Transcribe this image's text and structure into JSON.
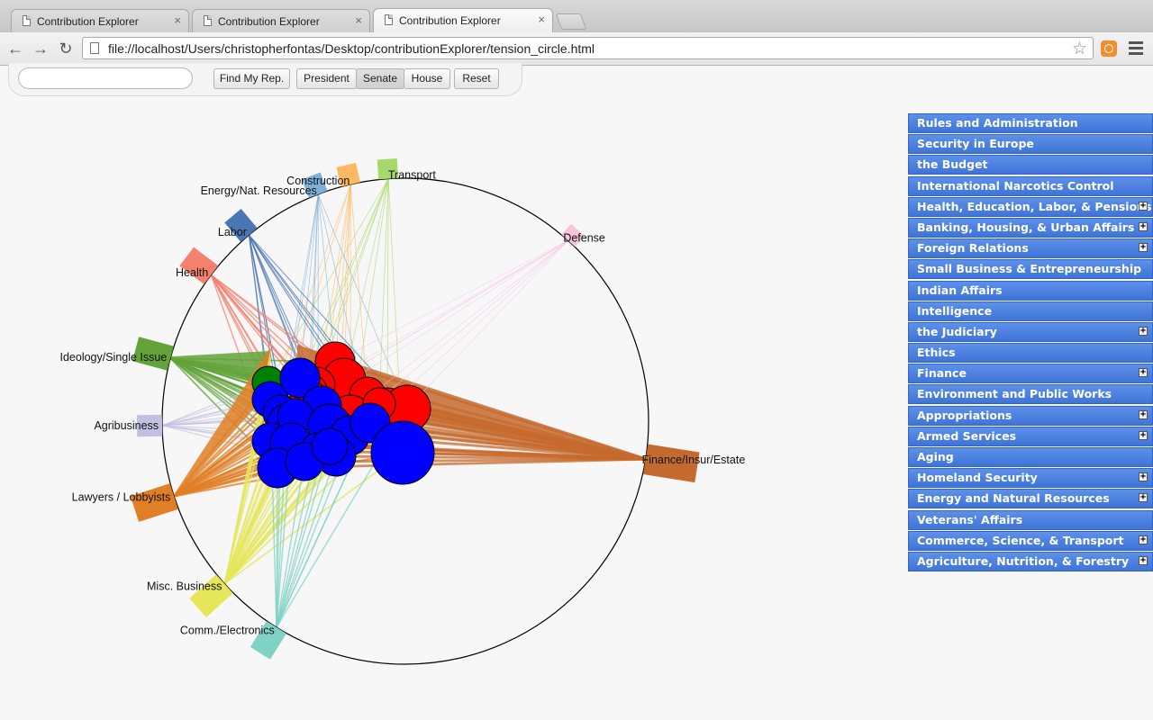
{
  "browser": {
    "tabs": [
      {
        "title": "Contribution Explorer",
        "active": false
      },
      {
        "title": "Contribution Explorer",
        "active": false
      },
      {
        "title": "Contribution Explorer",
        "active": true
      }
    ],
    "url": "file://localhost/Users/christopherfontas/Desktop/contributionExplorer/tension_circle.html",
    "close_glyph": "×"
  },
  "controls": {
    "search": {
      "value": "",
      "placeholder": ""
    },
    "find_label": "Find My Rep.",
    "chambers": [
      {
        "label": "President",
        "selected": false
      },
      {
        "label": "Senate",
        "selected": true
      },
      {
        "label": "House",
        "selected": false
      }
    ],
    "reset_label": "Reset"
  },
  "viz": {
    "ring": {
      "color": "#000000"
    },
    "party_colors": {
      "D": "#0000ff",
      "R": "#ff0000",
      "I": "#008000"
    },
    "sectors": [
      {
        "label": "Transport",
        "color": "#a6d96a",
        "weight": 2,
        "angle": 94
      },
      {
        "label": "Construction",
        "color": "#fdb863",
        "weight": 2,
        "angle": 103
      },
      {
        "label": "Energy/Nat. Resources",
        "color": "#7fb1d8",
        "weight": 2,
        "angle": 111
      },
      {
        "label": "Labor",
        "color": "#4a76b5",
        "weight": 3,
        "angle": 130
      },
      {
        "label": "Health",
        "color": "#f4806e",
        "weight": 4,
        "angle": 143
      },
      {
        "label": "Ideology/Single Issue",
        "color": "#63a33a",
        "weight": 5,
        "angle": 165
      },
      {
        "label": "Agribusiness",
        "color": "#c3bfe0",
        "weight": 3,
        "angle": 181
      },
      {
        "label": "Lawyers / Lobbyists",
        "color": "#e07f25",
        "weight": 6,
        "angle": 198
      },
      {
        "label": "Misc. Business",
        "color": "#e5e65a",
        "weight": 5,
        "angle": 222
      },
      {
        "label": "Comm./Electronics",
        "color": "#7fd2c5",
        "weight": 4,
        "angle": 238
      },
      {
        "label": "Finance/Insur/Estate",
        "color": "#c56a2e",
        "weight": 8,
        "angle": 351
      },
      {
        "label": "Defense",
        "color": "#f8c3dd",
        "weight": 1,
        "angle": 48
      }
    ],
    "members": [
      {
        "party": "I",
        "size": 18
      },
      {
        "party": "R",
        "size": 22
      },
      {
        "party": "R",
        "size": 24
      },
      {
        "party": "R",
        "size": 20
      },
      {
        "party": "R",
        "size": 18
      },
      {
        "party": "R",
        "size": 20
      },
      {
        "party": "R",
        "size": 22
      },
      {
        "party": "R",
        "size": 26
      },
      {
        "party": "R",
        "size": 24
      },
      {
        "party": "R",
        "size": 18
      },
      {
        "party": "R",
        "size": 20
      },
      {
        "party": "D",
        "size": 20
      },
      {
        "party": "D",
        "size": 22
      },
      {
        "party": "D",
        "size": 20
      },
      {
        "party": "D",
        "size": 22
      },
      {
        "party": "D",
        "size": 21
      },
      {
        "party": "D",
        "size": 20
      },
      {
        "party": "D",
        "size": 24
      },
      {
        "party": "D",
        "size": 22
      },
      {
        "party": "D",
        "size": 22
      },
      {
        "party": "D",
        "size": 20
      },
      {
        "party": "D",
        "size": 23
      },
      {
        "party": "D",
        "size": 20
      },
      {
        "party": "D",
        "size": 22
      },
      {
        "party": "D",
        "size": 35
      },
      {
        "party": "D",
        "size": 22
      },
      {
        "party": "D",
        "size": 21
      },
      {
        "party": "D",
        "size": 20
      }
    ]
  },
  "committees": {
    "expand_glyph": "+",
    "items": [
      {
        "label": "Rules and Administration",
        "expandable": false
      },
      {
        "label": "Security in Europe",
        "expandable": false
      },
      {
        "label": "the Budget",
        "expandable": false
      },
      {
        "label": "International Narcotics Control",
        "expandable": false
      },
      {
        "label": "Health, Education, Labor, & Pensions",
        "expandable": true
      },
      {
        "label": "Banking, Housing, & Urban Affairs",
        "expandable": true
      },
      {
        "label": "Foreign Relations",
        "expandable": true
      },
      {
        "label": "Small Business & Entrepreneurship",
        "expandable": false
      },
      {
        "label": "Indian Affairs",
        "expandable": false
      },
      {
        "label": "Intelligence",
        "expandable": false
      },
      {
        "label": "the Judiciary",
        "expandable": true
      },
      {
        "label": "Ethics",
        "expandable": false
      },
      {
        "label": "Finance",
        "expandable": true
      },
      {
        "label": "Environment and Public Works",
        "expandable": false
      },
      {
        "label": "Appropriations",
        "expandable": true
      },
      {
        "label": "Armed Services",
        "expandable": true
      },
      {
        "label": "Aging",
        "expandable": false
      },
      {
        "label": "Homeland Security",
        "expandable": true
      },
      {
        "label": "Energy and Natural Resources",
        "expandable": true
      },
      {
        "label": "Veterans' Affairs",
        "expandable": false
      },
      {
        "label": "Commerce, Science, & Transport",
        "expandable": true
      },
      {
        "label": "Agriculture, Nutrition, & Forestry",
        "expandable": true
      }
    ]
  }
}
